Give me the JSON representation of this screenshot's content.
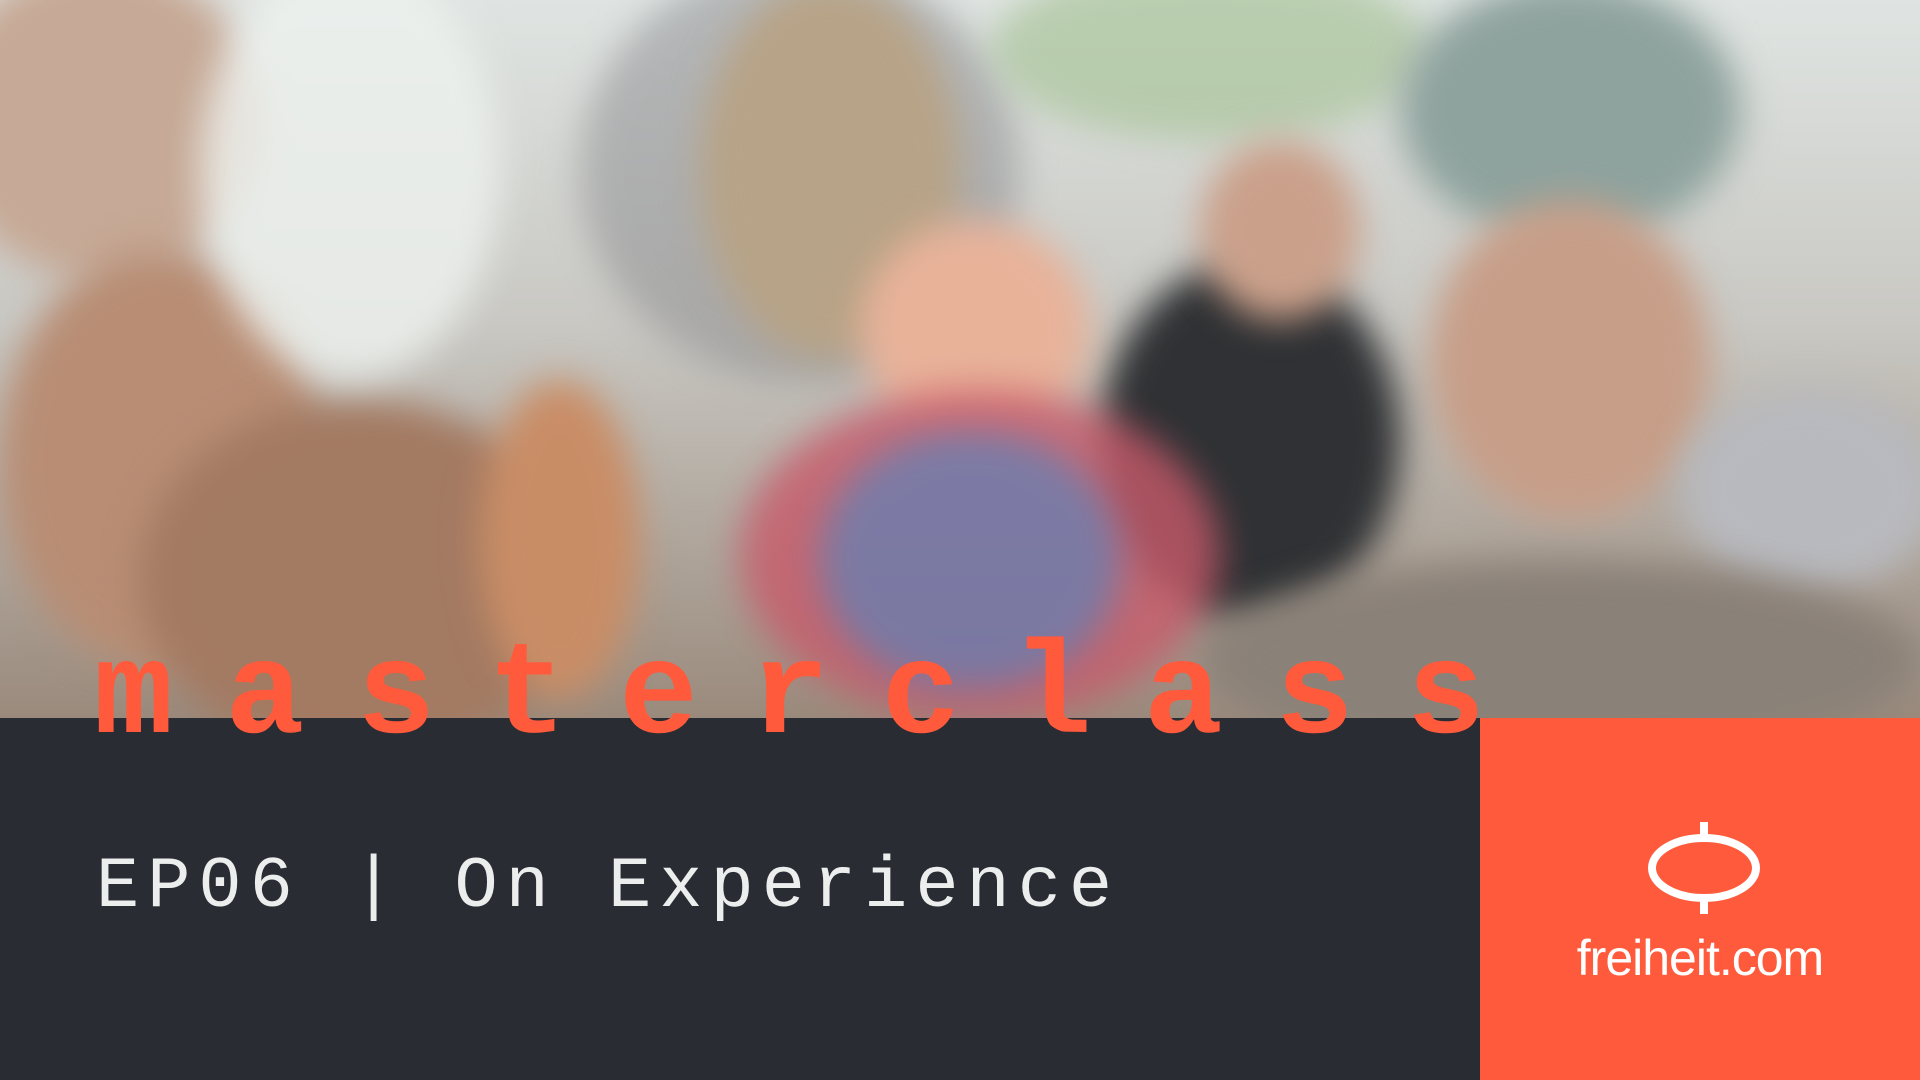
{
  "banner": {
    "headline": "masterclass",
    "episode_title": "EP06 | On Experience",
    "brand": {
      "wordmark": "freiheit.com",
      "icon": "freiheit-logo-icon"
    },
    "colors": {
      "accent": "#ff5a3c",
      "dark_band": "#2a2c33",
      "text_light": "#eceeee"
    }
  }
}
